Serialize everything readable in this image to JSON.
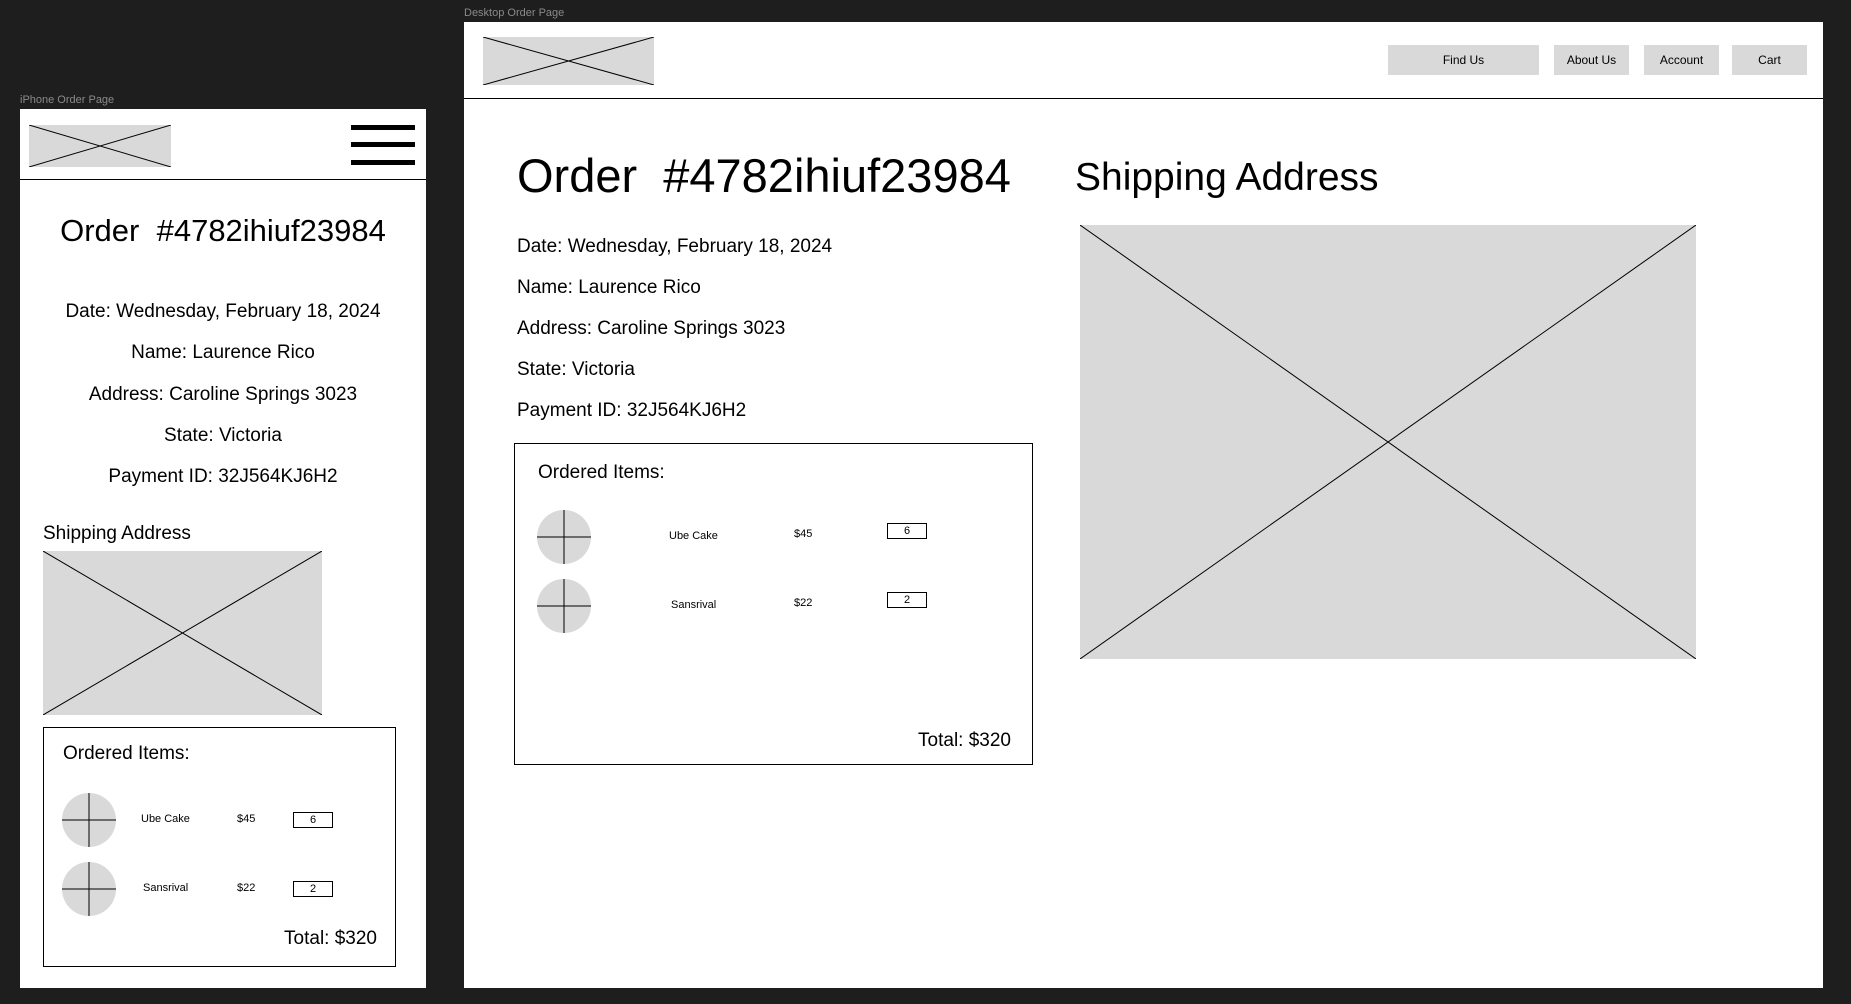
{
  "mobile": {
    "frame_label": "iPhone Order Page",
    "order_title": "Order  #4782ihiuf23984",
    "date": "Date: Wednesday, February 18, 2024",
    "name": "Name: Laurence Rico",
    "address": "Address: Caroline Springs 3023",
    "state": "State: Victoria",
    "payment": "Payment ID: 32J564KJ6H2",
    "shipping_heading": "Shipping Address",
    "ordered_heading": "Ordered Items:",
    "items": [
      {
        "name": "Ube Cake",
        "price": "$45",
        "qty": "6"
      },
      {
        "name": "Sansrival",
        "price": "$22",
        "qty": "2"
      }
    ],
    "total": "Total: $320",
    "menu_icon": "hamburger-menu-icon"
  },
  "desktop": {
    "frame_label": "Desktop Order Page",
    "nav": [
      "Find Us",
      "About Us",
      "Account",
      "Cart"
    ],
    "order_title": "Order  #4782ihiuf23984",
    "shipping_heading": "Shipping Address",
    "date": "Date: Wednesday, February 18, 2024",
    "name": "Name: Laurence Rico",
    "address": "Address: Caroline Springs 3023",
    "state": "State: Victoria",
    "payment": "Payment ID: 32J564KJ6H2",
    "ordered_heading": "Ordered Items:",
    "items": [
      {
        "name": "Ube Cake",
        "price": "$45",
        "qty": "6"
      },
      {
        "name": "Sansrival",
        "price": "$22",
        "qty": "2"
      }
    ],
    "total": "Total: $320"
  },
  "colors": {
    "canvas": "#1e1e1e",
    "frame": "#ffffff",
    "placeholder": "#d9d9d9",
    "label": "#8a8a8a"
  }
}
